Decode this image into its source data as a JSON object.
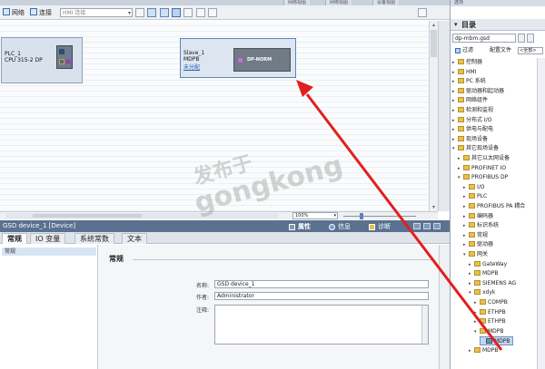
{
  "top_tabs": [
    "网络视图",
    "网络视图",
    "设备视图"
  ],
  "toolbar": {
    "network_label": "网络",
    "connect_label": "连接",
    "connection_type": "HMI 连接"
  },
  "devices": {
    "plc": {
      "name": "PLC_1",
      "type": "CPU 315-2 DP"
    },
    "slave": {
      "name": "Slave_1",
      "type": "MDPB",
      "status": "未分配",
      "module_label": "DP-NORM"
    }
  },
  "zoom": {
    "value": "100%"
  },
  "properties": {
    "title": "GSD device_1 [Device]",
    "tabs": {
      "properties": "属性",
      "info": "信息",
      "diagnostics": "诊断"
    },
    "subtabs": [
      "常规",
      "IO 变量",
      "系统常数",
      "文本"
    ],
    "nav_items": [
      "常规"
    ],
    "section_title": "常规",
    "fields": {
      "name_label": "名称:",
      "name_value": "GSD device_1",
      "author_label": "作者:",
      "author_value": "Administrator",
      "comment_label": "注释:"
    }
  },
  "catalog": {
    "top_label": "选项",
    "title": "目录",
    "search_value": "dp-mbm.gsd",
    "filter_label": "过滤",
    "profile_label": "配置文件",
    "profile_value": "<全部>",
    "tree": [
      {
        "label": "控制器",
        "level": 0,
        "expanded": false,
        "icon": "folder"
      },
      {
        "label": "HMI",
        "level": 0,
        "expanded": false,
        "icon": "folder"
      },
      {
        "label": "PC 系统",
        "level": 0,
        "expanded": false,
        "icon": "folder"
      },
      {
        "label": "驱动器和起动器",
        "level": 0,
        "expanded": false,
        "icon": "folder"
      },
      {
        "label": "网络组件",
        "level": 0,
        "expanded": false,
        "icon": "folder"
      },
      {
        "label": "检测和监视",
        "level": 0,
        "expanded": false,
        "icon": "folder"
      },
      {
        "label": "分布式 I/O",
        "level": 0,
        "expanded": false,
        "icon": "folder"
      },
      {
        "label": "供电与配电",
        "level": 0,
        "expanded": false,
        "icon": "folder"
      },
      {
        "label": "现场设备",
        "level": 0,
        "expanded": false,
        "icon": "folder"
      },
      {
        "label": "其它现场设备",
        "level": 0,
        "expanded": true,
        "icon": "folder"
      },
      {
        "label": "其它以太网设备",
        "level": 1,
        "expanded": false,
        "icon": "folder"
      },
      {
        "label": "PROFINET IO",
        "level": 1,
        "expanded": false,
        "icon": "folder"
      },
      {
        "label": "PROFIBUS DP",
        "level": 1,
        "expanded": true,
        "icon": "folder"
      },
      {
        "label": "I/O",
        "level": 2,
        "expanded": false,
        "icon": "folder"
      },
      {
        "label": "PLC",
        "level": 2,
        "expanded": false,
        "icon": "folder"
      },
      {
        "label": "PROFIBUS PA 耦合",
        "level": 2,
        "expanded": false,
        "icon": "folder"
      },
      {
        "label": "编码器",
        "level": 2,
        "expanded": false,
        "icon": "folder"
      },
      {
        "label": "标识系统",
        "level": 2,
        "expanded": false,
        "icon": "folder"
      },
      {
        "label": "常规",
        "level": 2,
        "expanded": false,
        "icon": "folder"
      },
      {
        "label": "驱动器",
        "level": 2,
        "expanded": false,
        "icon": "folder"
      },
      {
        "label": "网关",
        "level": 2,
        "expanded": true,
        "icon": "folder"
      },
      {
        "label": "GateWay",
        "level": 3,
        "expanded": false,
        "icon": "folder"
      },
      {
        "label": "MDPB",
        "level": 3,
        "expanded": false,
        "icon": "folder"
      },
      {
        "label": "SIEMENS AG",
        "level": 3,
        "expanded": false,
        "icon": "folder"
      },
      {
        "label": "xdyk",
        "level": 3,
        "expanded": true,
        "icon": "folder"
      },
      {
        "label": "COMPB",
        "level": 4,
        "expanded": false,
        "icon": "folder"
      },
      {
        "label": "ETHPB",
        "level": 4,
        "expanded": false,
        "icon": "folder"
      },
      {
        "label": "ETHPB",
        "level": 4,
        "expanded": false,
        "icon": "folder"
      },
      {
        "label": "MDPB",
        "level": 4,
        "expanded": true,
        "icon": "folder"
      },
      {
        "label": "MDPB",
        "level": 5,
        "expanded": null,
        "icon": "module",
        "selected": true
      },
      {
        "label": "MDPB",
        "level": 3,
        "expanded": false,
        "icon": "folder"
      }
    ]
  },
  "watermark": {
    "line1": "发布于",
    "line2": "gongkong"
  },
  "colors": {
    "accent": "#5a7190",
    "selection": "#c3d6ee",
    "arrow": "#e02020",
    "unassigned_link": "#2860b8"
  }
}
